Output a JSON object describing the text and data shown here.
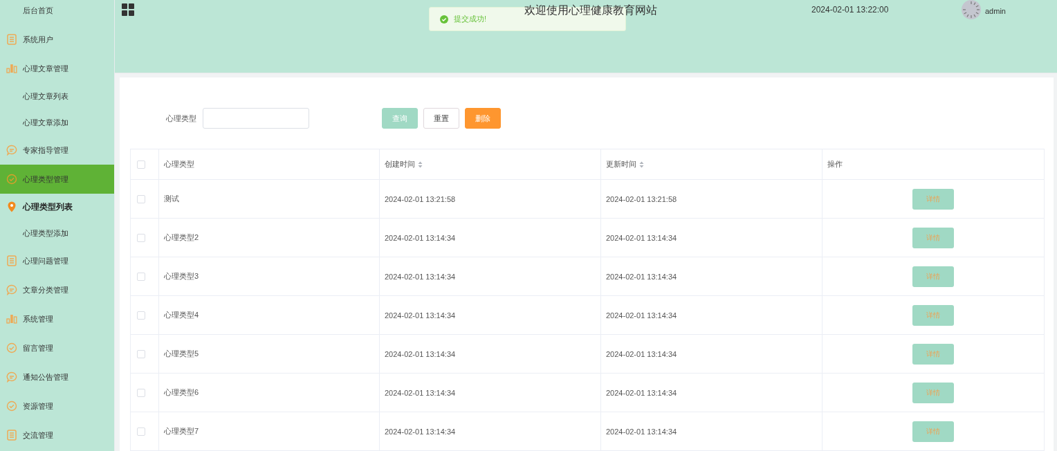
{
  "sidebar": {
    "items": [
      {
        "label": "后台首页",
        "kind": "plain",
        "selected": false
      },
      {
        "label": "系统用户",
        "kind": "doc",
        "selected": false
      },
      {
        "label": "心理文章管理",
        "kind": "chart",
        "selected": false,
        "children": [
          {
            "label": "心理文章列表",
            "selected": false
          },
          {
            "label": "心理文章添加",
            "selected": false
          }
        ]
      },
      {
        "label": "专家指导管理",
        "kind": "chat",
        "selected": false
      },
      {
        "label": "心理类型管理",
        "kind": "check",
        "selected": true,
        "children": [
          {
            "label": "心理类型列表",
            "selected": true
          },
          {
            "label": "心理类型添加",
            "selected": false
          }
        ]
      },
      {
        "label": "心理问题管理",
        "kind": "doc",
        "selected": false
      },
      {
        "label": "文章分类管理",
        "kind": "chat",
        "selected": false
      },
      {
        "label": "系统管理",
        "kind": "chart",
        "selected": false
      },
      {
        "label": "留言管理",
        "kind": "check",
        "selected": false
      },
      {
        "label": "通知公告管理",
        "kind": "chat",
        "selected": false
      },
      {
        "label": "资源管理",
        "kind": "check",
        "selected": false
      },
      {
        "label": "交流管理",
        "kind": "doc",
        "selected": false
      }
    ]
  },
  "header": {
    "title": "欢迎使用心理健康教育网站",
    "datetime": "2024-02-01 13:22:00",
    "user": "admin"
  },
  "toast": {
    "message": "提交成功!"
  },
  "search": {
    "label": "心理类型",
    "buttons": [
      {
        "label": "查询",
        "kind": "primary"
      },
      {
        "label": "重置",
        "kind": "plain"
      },
      {
        "label": "删除",
        "kind": "danger"
      }
    ]
  },
  "table": {
    "select_all": false,
    "columns": [
      {
        "label": "心理类型",
        "sortable": false
      },
      {
        "label": "创建时间",
        "sortable": true
      },
      {
        "label": "更新时间",
        "sortable": true
      },
      {
        "label": "操作",
        "sortable": false
      }
    ],
    "rows": [
      {
        "checked": false,
        "type": "测试",
        "created": "2024-02-01 13:21:58",
        "updated": "2024-02-01 13:21:58",
        "action": "详情"
      },
      {
        "checked": false,
        "type": "心理类型2",
        "created": "2024-02-01 13:14:34",
        "updated": "2024-02-01 13:14:34",
        "action": "详情"
      },
      {
        "checked": false,
        "type": "心理类型3",
        "created": "2024-02-01 13:14:34",
        "updated": "2024-02-01 13:14:34",
        "action": "详情"
      },
      {
        "checked": false,
        "type": "心理类型4",
        "created": "2024-02-01 13:14:34",
        "updated": "2024-02-01 13:14:34",
        "action": "详情"
      },
      {
        "checked": false,
        "type": "心理类型5",
        "created": "2024-02-01 13:14:34",
        "updated": "2024-02-01 13:14:34",
        "action": "详情"
      },
      {
        "checked": false,
        "type": "心理类型6",
        "created": "2024-02-01 13:14:34",
        "updated": "2024-02-01 13:14:34",
        "action": "详情"
      },
      {
        "checked": false,
        "type": "心理类型7",
        "created": "2024-02-01 13:14:34",
        "updated": "2024-02-01 13:14:34",
        "action": "详情"
      }
    ]
  }
}
